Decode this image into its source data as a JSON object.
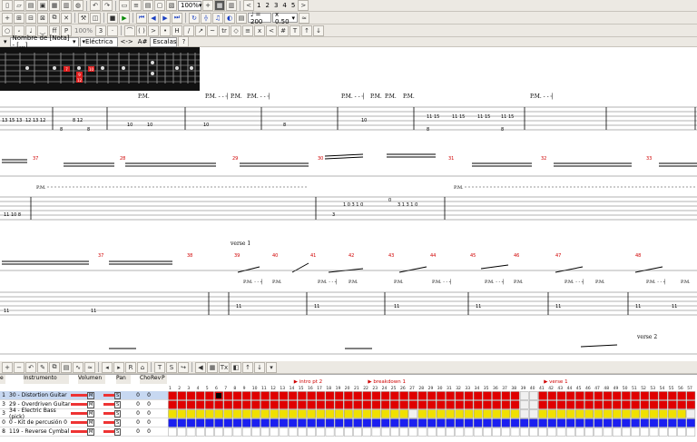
{
  "toolbar1": {
    "zoom": "100%",
    "pages": [
      "1",
      "2",
      "3",
      "4",
      "5"
    ],
    "next": ">"
  },
  "toolbar2": {
    "tempo": "♩ = 200",
    "speed": "x 0.50"
  },
  "toolbar3": {
    "percent": "100%"
  },
  "toolbar4": {
    "note_name": "Nombre de [Nota] - [...]",
    "instrument": "Eléctrica",
    "arrows": "<->",
    "note": "A#",
    "scales": "Escalas",
    "help": "?"
  },
  "fretboard": {
    "dots": [
      "7",
      "10",
      "9",
      "12"
    ]
  },
  "score": {
    "pm": "P.M.",
    "pm_dash": "P.M. - - ┤",
    "tab1_numbers": [
      "11",
      "13 15 13",
      "12 13 12",
      "8",
      "8 12",
      "8",
      "10",
      "10",
      "10",
      "8",
      "8",
      "8",
      "10",
      "8",
      "11 15",
      "11 15",
      "11 15",
      "11 15",
      "8",
      "8",
      "8",
      "8",
      "8",
      "8"
    ],
    "row2_measures": [
      "37",
      "28",
      "29",
      "30",
      "31",
      "32",
      "33"
    ],
    "row3_measures": [
      "37",
      "38",
      "39",
      "40",
      "41",
      "42",
      "43",
      "44",
      "45",
      "46",
      "47",
      "48"
    ],
    "tab2_numbers": [
      "11 10 8",
      "3",
      "1 0 3 1 0",
      "3 1 3 1 0",
      "0"
    ],
    "section_verse1": "verse 1",
    "section_verse2": "verse 2",
    "tab3_numbers": [
      "11",
      "11",
      "11",
      "11",
      "11",
      "11",
      "11",
      "11",
      "11"
    ]
  },
  "tracks": {
    "headers": [
      "e",
      "Instrumento",
      "Volumen",
      "Pan",
      "Cho",
      "Rev",
      "P"
    ],
    "rows": [
      {
        "num": "1",
        "name": "30 - Distortion Guitar",
        "vol": "M",
        "pan": "S"
      },
      {
        "num": "3",
        "name": "29 - Overdriven Guitar",
        "vol": "M",
        "pan": "S"
      },
      {
        "num": "3",
        "name": "34 - Electric Bass (pick)",
        "vol": "M",
        "pan": "S"
      },
      {
        "num": "0",
        "name": "0 - Kit de percusión 0",
        "vol": "M",
        "pan": "S"
      },
      {
        "num": "8",
        "name": "119 - Reverse Cymbal",
        "vol": "M",
        "pan": "S"
      }
    ],
    "cho_rev": "0",
    "markers": [
      "intro pt 2",
      "breakdown 1",
      "verse 1"
    ],
    "measures": [
      "1",
      "2",
      "3",
      "4",
      "5",
      "6",
      "7",
      "8",
      "9",
      "10",
      "11",
      "12",
      "13",
      "14",
      "15",
      "16",
      "17",
      "18",
      "19",
      "20",
      "21",
      "22",
      "23",
      "24",
      "25",
      "26",
      "27",
      "28",
      "29",
      "30",
      "31",
      "32",
      "33",
      "34",
      "35",
      "36",
      "37",
      "38",
      "39",
      "40",
      "41",
      "42",
      "43",
      "44",
      "45",
      "46",
      "47",
      "48",
      "49",
      "50",
      "51",
      "52",
      "53",
      "54",
      "55",
      "56",
      "57"
    ],
    "colors": {
      "red": "#e00000",
      "yellow": "#f0e000",
      "blue": "#1b1ff0"
    }
  }
}
